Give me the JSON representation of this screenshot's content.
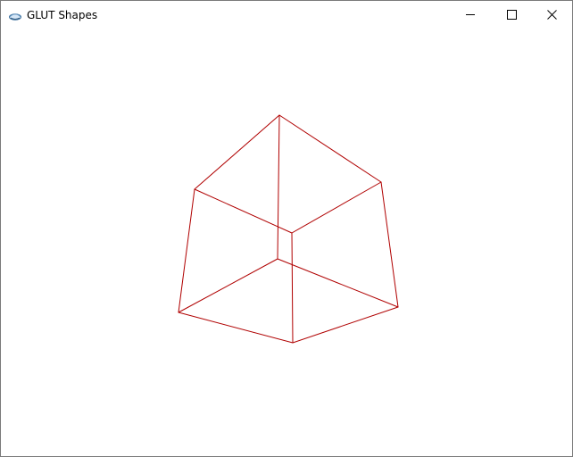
{
  "window": {
    "title": "GLUT Shapes"
  },
  "icons": {
    "app": "glut-app-icon",
    "minimize": "minimize-icon",
    "maximize": "maximize-icon",
    "close": "close-icon"
  },
  "colors": {
    "wireframe": "#b00000",
    "background": "#ffffff",
    "title_text": "#000000",
    "caption_glyph": "#000000"
  },
  "scene": {
    "shape": "wireframe cube"
  }
}
